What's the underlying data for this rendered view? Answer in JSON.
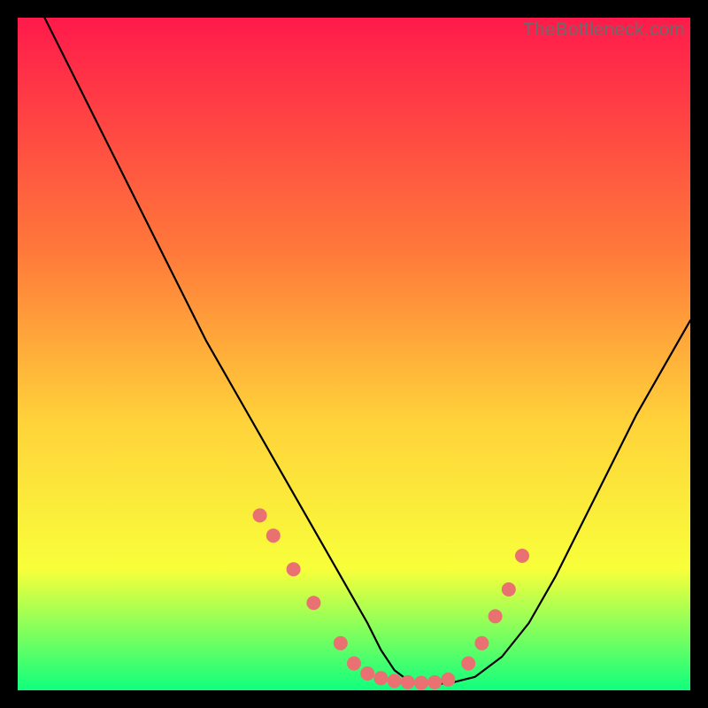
{
  "watermark": "TheBottleneck.com",
  "colors": {
    "gradient_top": "#ff1a4b",
    "gradient_mid1": "#ff7a3a",
    "gradient_mid2": "#ffd23a",
    "gradient_mid3": "#f8ff3a",
    "gradient_bottom": "#10ff7e",
    "curve": "#000000",
    "points": "#e97171",
    "frame": "#000000"
  },
  "chart_data": {
    "type": "line",
    "title": "",
    "xlabel": "",
    "ylabel": "",
    "xlim": [
      0,
      100
    ],
    "ylim": [
      0,
      100
    ],
    "series": [
      {
        "name": "bottleneck-curve",
        "x": [
          4,
          8,
          12,
          16,
          20,
          24,
          28,
          32,
          36,
          40,
          44,
          48,
          52,
          54,
          56,
          58,
          60,
          64,
          68,
          72,
          76,
          80,
          84,
          88,
          92,
          96,
          100
        ],
        "y": [
          100,
          92,
          84,
          76,
          68,
          60,
          52,
          45,
          38,
          31,
          24,
          17,
          10,
          6,
          3,
          1.5,
          1,
          1,
          2,
          5,
          10,
          17,
          25,
          33,
          41,
          48,
          55
        ]
      }
    ],
    "points": {
      "name": "highlighted-scatter",
      "xy": [
        [
          36,
          26
        ],
        [
          38,
          23
        ],
        [
          41,
          18
        ],
        [
          44,
          13
        ],
        [
          48,
          7
        ],
        [
          50,
          4
        ],
        [
          52,
          2.5
        ],
        [
          54,
          1.8
        ],
        [
          56,
          1.4
        ],
        [
          58,
          1.2
        ],
        [
          60,
          1.1
        ],
        [
          62,
          1.2
        ],
        [
          64,
          1.6
        ],
        [
          67,
          4
        ],
        [
          69,
          7
        ],
        [
          71,
          11
        ],
        [
          73,
          15
        ],
        [
          75,
          20
        ]
      ]
    }
  }
}
